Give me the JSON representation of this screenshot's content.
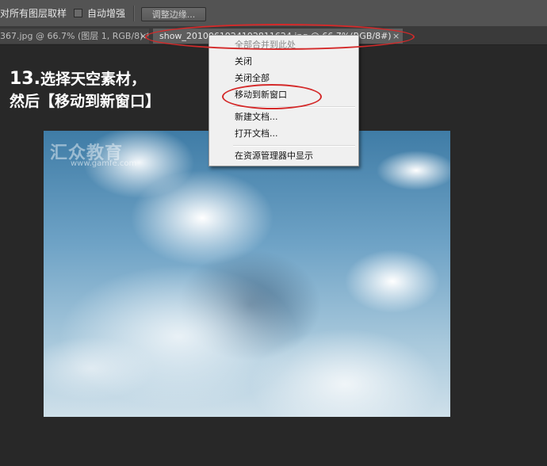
{
  "options_bar": {
    "sample_all_layers": "对所有图层取样",
    "auto_enhance": "自动增强",
    "refine_edge": "调整边缘..."
  },
  "tabs": [
    {
      "label": "367.jpg @ 66.7% (图层 1, RGB/8) *",
      "close": "×"
    },
    {
      "label": "show_2010061924192811624.jpg @ 66.7%(RGB/8#)",
      "close": "×"
    }
  ],
  "instruction": {
    "number": "13.",
    "line1": "选择天空素材，",
    "line2": "然后【移动到新窗口】"
  },
  "watermark": {
    "brand": "汇众教育",
    "url": "www.gamfe.com"
  },
  "context_menu": {
    "items": [
      {
        "label": "全部合并到此处",
        "disabled": true
      },
      {
        "label": "关闭",
        "disabled": false
      },
      {
        "label": "关闭全部",
        "disabled": false
      },
      {
        "label": "移动到新窗口",
        "disabled": false
      },
      {
        "label": "新建文档...",
        "disabled": false
      },
      {
        "label": "打开文档...",
        "disabled": false
      },
      {
        "label": "在资源管理器中显示",
        "disabled": false
      }
    ]
  },
  "colors": {
    "annotation": "#d42a2a",
    "workspace": "#282828",
    "menu_bg": "#f0f0f0"
  }
}
